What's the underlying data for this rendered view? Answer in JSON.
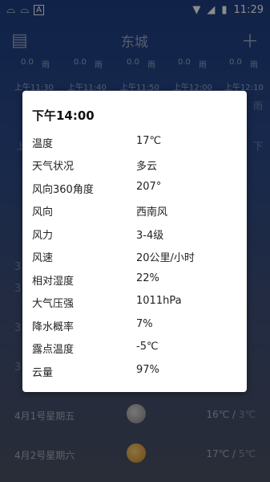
{
  "status_bar": {
    "left_icons": [
      "app-notification-icon",
      "app-notification-icon",
      "a-badge-icon"
    ],
    "time": "11:29"
  },
  "app_bar": {
    "city": "东城",
    "left_icon": "map-book-icon",
    "right_icon": "plus-icon"
  },
  "hourly": {
    "precip_row": [
      "0.0",
      "雨",
      "0.0",
      "雨",
      "0.0",
      "雨",
      "0.0",
      "雨",
      "0.0",
      "雨"
    ],
    "times": [
      "上午11:30",
      "上午11:40",
      "上午11:50",
      "上午12:00",
      "上午12:10"
    ],
    "lower_left": "上",
    "lower_right": "下",
    "side_right": "雨"
  },
  "daily": [
    {
      "date": "4月1号星期五",
      "icon": "cloudy-icon",
      "hi": "16℃",
      "lo": "3℃"
    },
    {
      "date": "4月2号星期六",
      "icon": "sunny-icon",
      "hi": "17℃",
      "lo": "5℃"
    }
  ],
  "side_numbers": [
    "3",
    "3",
    "3",
    "3"
  ],
  "dialog": {
    "title": "下午14:00",
    "rows": [
      {
        "k": "温度",
        "v": "17℃"
      },
      {
        "k": "天气状况",
        "v": "多云"
      },
      {
        "k": "风向360角度",
        "v": "207°"
      },
      {
        "k": "风向",
        "v": "西南风"
      },
      {
        "k": "风力",
        "v": "3-4级"
      },
      {
        "k": "风速",
        "v": "20公里/小时"
      },
      {
        "k": "相对湿度",
        "v": "22%"
      },
      {
        "k": "大气压强",
        "v": "1011hPa"
      },
      {
        "k": "降水概率",
        "v": "7%"
      },
      {
        "k": "露点温度",
        "v": "-5℃"
      },
      {
        "k": "云量",
        "v": "97%"
      }
    ]
  }
}
